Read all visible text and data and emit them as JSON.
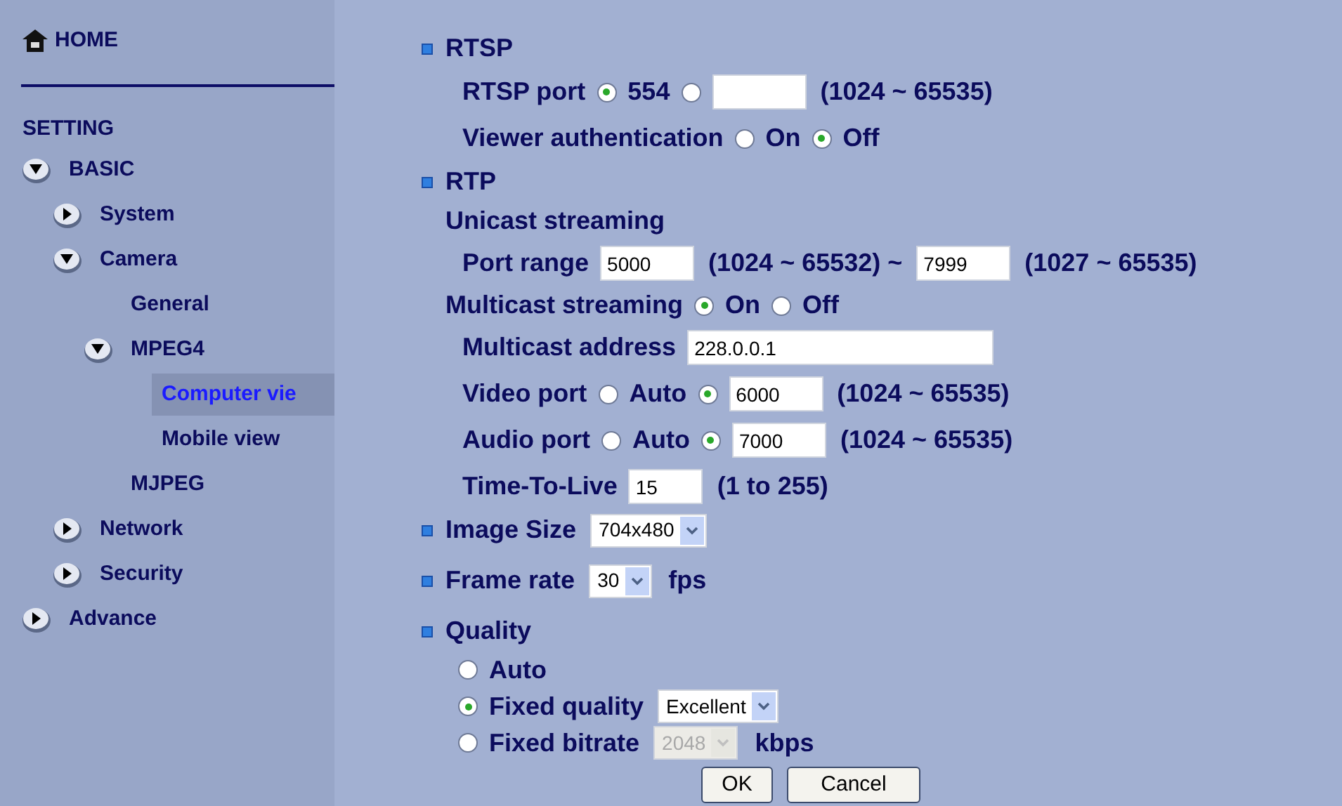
{
  "sidebar": {
    "home": "HOME",
    "heading": "SETTING",
    "items": [
      {
        "label": "BASIC",
        "expanded": true,
        "selected": false,
        "children": [
          {
            "label": "System",
            "expanded": false,
            "selected": false
          },
          {
            "label": "Camera",
            "expanded": true,
            "selected": false,
            "children": [
              {
                "label": "General",
                "selected": false
              },
              {
                "label": "MPEG4",
                "expanded": true,
                "selected": false,
                "children": [
                  {
                    "label": "Computer vie",
                    "selected": true
                  },
                  {
                    "label": "Mobile view",
                    "selected": false
                  }
                ]
              },
              {
                "label": "MJPEG",
                "selected": false
              }
            ]
          },
          {
            "label": "Network",
            "expanded": false,
            "selected": false
          },
          {
            "label": "Security",
            "expanded": false,
            "selected": false
          }
        ]
      },
      {
        "label": "Advance",
        "expanded": false,
        "selected": false
      }
    ]
  },
  "sections": [
    {
      "title": "RTSP",
      "children": [
        {
          "kind": "row",
          "parts": [
            {
              "kind": "label",
              "text": "RTSP port"
            },
            {
              "kind": "radio",
              "selected": true,
              "text": "554"
            },
            {
              "kind": "radio",
              "selected": false
            },
            {
              "kind": "field"
            },
            {
              "kind": "text",
              "text": "(1024 ~ 65535)"
            }
          ]
        },
        {
          "kind": "row",
          "parts": [
            {
              "kind": "label",
              "text": "Viewer authentication"
            },
            {
              "kind": "radio",
              "selected": false,
              "text": "On"
            },
            {
              "kind": "radio",
              "selected": true,
              "text": "Off"
            }
          ]
        }
      ]
    },
    {
      "title": "RTP",
      "children": [
        {
          "kind": "subheading",
          "parts": [
            {
              "kind": "label",
              "text": "Unicast streaming"
            }
          ]
        },
        {
          "kind": "row",
          "parts": [
            {
              "kind": "label",
              "text": "Port range"
            },
            {
              "kind": "field",
              "value": "5000"
            },
            {
              "kind": "text",
              "text": "(1024 ~ 65532) ~"
            },
            {
              "kind": "field",
              "value": "7999"
            },
            {
              "kind": "text",
              "text": "(1027 ~ 65535)"
            }
          ]
        },
        {
          "kind": "subheading",
          "parts": [
            {
              "kind": "label",
              "text": "Multicast streaming"
            },
            {
              "kind": "radio",
              "selected": true,
              "text": "On"
            },
            {
              "kind": "radio",
              "selected": false,
              "text": "Off"
            }
          ]
        },
        {
          "kind": "row",
          "parts": [
            {
              "kind": "label",
              "text": "Multicast address"
            },
            {
              "kind": "address_field",
              "value": "228.0.0.1"
            }
          ]
        },
        {
          "kind": "row",
          "parts": [
            {
              "kind": "label",
              "text": "Video port"
            },
            {
              "kind": "radio",
              "selected": false,
              "text": "Auto"
            },
            {
              "kind": "radio",
              "selected": true
            },
            {
              "kind": "field",
              "value": "6000"
            },
            {
              "kind": "text",
              "text": "(1024 ~ 65535)"
            }
          ]
        },
        {
          "kind": "row",
          "parts": [
            {
              "kind": "label",
              "text": "Audio port"
            },
            {
              "kind": "radio",
              "selected": false,
              "text": "Auto"
            },
            {
              "kind": "radio",
              "selected": true
            },
            {
              "kind": "field",
              "value": "7000"
            },
            {
              "kind": "text",
              "text": "(1024 ~ 65535)"
            }
          ]
        },
        {
          "kind": "row",
          "parts": [
            {
              "kind": "label",
              "text": "Time-To-Live"
            },
            {
              "kind": "small_field",
              "value": "15"
            },
            {
              "kind": "text",
              "text": "(1 to 255)"
            }
          ]
        }
      ]
    },
    {
      "title": "Image Size",
      "parts": [
        {
          "kind": "select",
          "value": "704x480",
          "disabled": false
        }
      ]
    },
    {
      "title": "Frame rate",
      "parts": [
        {
          "kind": "select",
          "value": "30",
          "disabled": false
        },
        {
          "kind": "text",
          "text": "fps"
        }
      ]
    },
    {
      "title": "Quality",
      "children": [
        {
          "kind": "option",
          "parts": [
            {
              "kind": "radio",
              "selected": false,
              "text": "Auto"
            }
          ]
        },
        {
          "kind": "option",
          "parts": [
            {
              "kind": "radio",
              "selected": true,
              "text": "Fixed quality"
            },
            {
              "kind": "select",
              "value": "Excellent",
              "disabled": false
            }
          ]
        },
        {
          "kind": "option",
          "parts": [
            {
              "kind": "radio",
              "selected": false,
              "text": "Fixed bitrate"
            },
            {
              "kind": "select",
              "value": "2048",
              "disabled": true
            },
            {
              "kind": "text",
              "text": "kbps"
            }
          ]
        }
      ]
    }
  ],
  "buttons": [
    "OK",
    "Cancel"
  ]
}
